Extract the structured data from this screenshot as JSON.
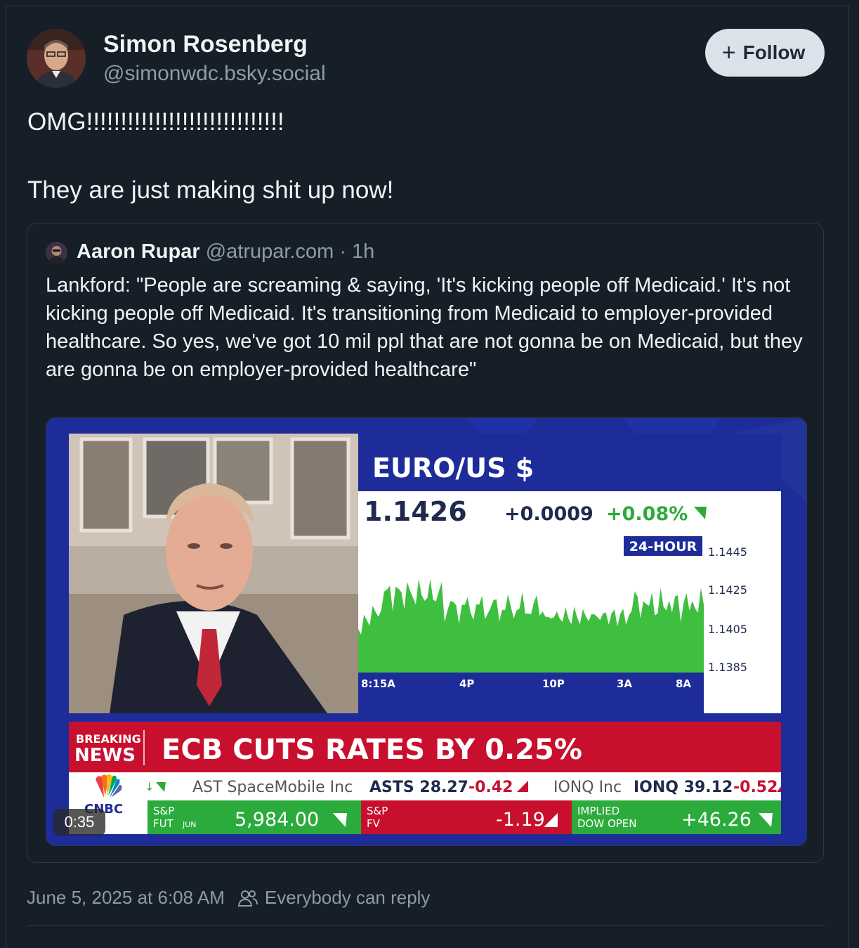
{
  "post": {
    "author_name": "Simon Rosenberg",
    "author_handle": "@simonwdc.bsky.social",
    "follow_label": "Follow",
    "text_line1": "OMG!!!!!!!!!!!!!!!!!!!!!!!!!!!!!",
    "text_line2": "They are just making shit up now!",
    "timestamp": "June 5, 2025 at 6:08 AM",
    "reply_setting": "Everybody can reply"
  },
  "quote": {
    "author_name": "Aaron Rupar",
    "author_handle": "@atrupar.com",
    "age": "· 1h",
    "text": "Lankford: \"People are screaming & saying, 'It's kicking people off Medicaid.' It's not kicking people off Medicaid. It's transitioning from Medicaid to employer-provided healthcare. So yes, we've got 10 mil ppl that are not gonna be on Medicaid, but they are gonna be on employer-provided healthcare\"",
    "video_duration": "0:35"
  },
  "video_frame": {
    "chart_title": "EURO/US $",
    "price": "1.1426",
    "change": "+0.0009",
    "change_pct": "+0.08%",
    "period": "24-HOUR",
    "y_ticks": [
      "1.1445",
      "1.1425",
      "1.1405",
      "1.1385"
    ],
    "x_ticks": [
      "8:15A",
      "4P",
      "10P",
      "3A",
      "8A"
    ],
    "breaking_top": "BREAKING",
    "breaking_bottom": "NEWS",
    "headline": "ECB CUTS RATES BY 0.25%",
    "network": "CNBC",
    "ticker1_name": "AST SpaceMobile Inc",
    "ticker1_sym": "ASTS 28.27",
    "ticker1_chg": "-0.42",
    "ticker2_name": "IONQ Inc",
    "ticker2_sym": "IONQ 39.12",
    "ticker2_chg": "-0.52",
    "sp_fut_label1": "S&P",
    "sp_fut_label2": "FUT",
    "sp_fut_month": "JUN",
    "sp_fut_value": "5,984.00",
    "sp_fv_label1": "S&P",
    "sp_fv_label2": "FV",
    "sp_fv_value": "-1.19",
    "dow_label1": "IMPLIED",
    "dow_label2": "DOW OPEN",
    "dow_value": "+46.26"
  },
  "colors": {
    "background": "#161e27",
    "text_primary": "#f1f3f5",
    "text_secondary": "#8d9bab",
    "follow_bg": "#dce2ea",
    "cnbc_blue": "#1d2c99",
    "cnbc_red": "#c8102e",
    "chart_green": "#3fbf3f"
  }
}
